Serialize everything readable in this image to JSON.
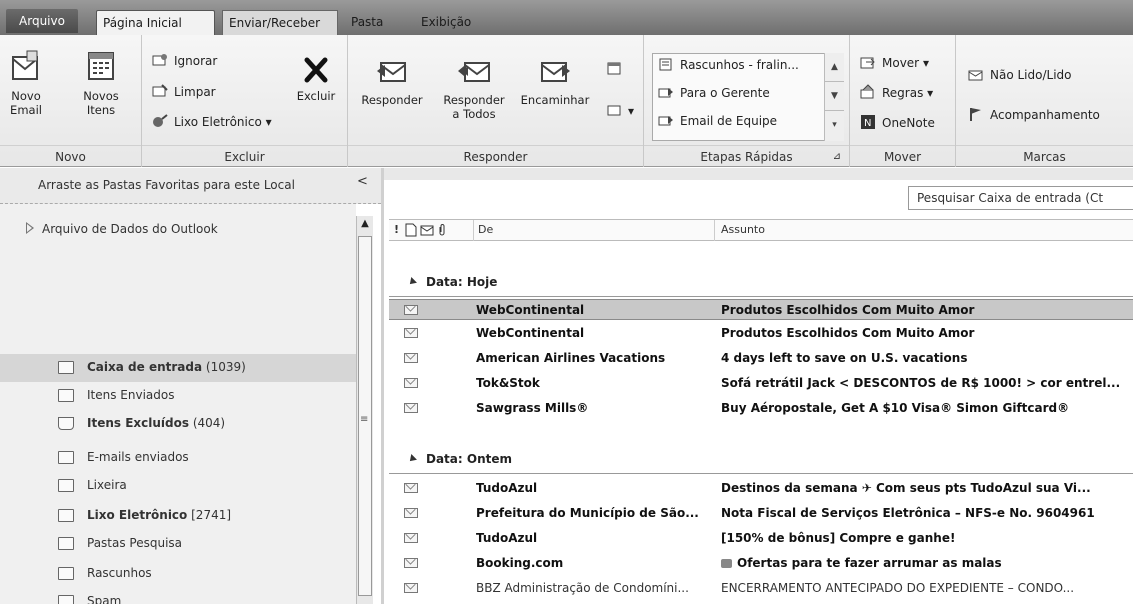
{
  "tabs": {
    "file": "Arquivo",
    "items": [
      "Página Inicial",
      "Enviar/Receber",
      "Pasta",
      "Exibição"
    ]
  },
  "ribbon": {
    "novo": {
      "label": "Novo",
      "new_email_1": "Novo",
      "new_email_2": "Email",
      "new_items_1": "Novos",
      "new_items_2": "Itens"
    },
    "excluir": {
      "label": "Excluir",
      "ignore": "Ignorar",
      "clean": "Limpar",
      "junk": "Lixo Eletrônico",
      "delete": "Excluir"
    },
    "responder": {
      "label": "Responder",
      "reply": "Responder",
      "reply_all_1": "Responder",
      "reply_all_2": "a Todos",
      "forward": "Encaminhar"
    },
    "quick_steps": {
      "label": "Etapas Rápidas",
      "items": [
        "Rascunhos - fralin...",
        "Para o Gerente",
        "Email de Equipe"
      ]
    },
    "mover": {
      "label": "Mover",
      "move": "Mover",
      "rules": "Regras",
      "onenote": "OneNote"
    },
    "marcas": {
      "label": "Marcas",
      "unread_read": "Não Lido/Lido",
      "followup": "Acompanhamento"
    }
  },
  "nav": {
    "favorites_hint": "Arraste as Pastas Favoritas para este Local",
    "collapse": "<",
    "root": "Arquivo de Dados do Outlook",
    "folders": [
      {
        "name": "Caixa de entrada",
        "count": "(1039)",
        "bold": true,
        "selected": true
      },
      {
        "name": "Itens Enviados",
        "count": "",
        "bold": false,
        "selected": false
      },
      {
        "name": "Itens Excluídos",
        "count": "(404)",
        "bold": true,
        "selected": false
      },
      {
        "name": "E-mails enviados",
        "count": "",
        "bold": false,
        "selected": false
      },
      {
        "name": "Lixeira",
        "count": "",
        "bold": false,
        "selected": false
      },
      {
        "name": "Lixo Eletrônico",
        "count": "[2741]",
        "bold": true,
        "selected": false
      },
      {
        "name": "Pastas Pesquisa",
        "count": "",
        "bold": false,
        "selected": false
      },
      {
        "name": "Rascunhos",
        "count": "",
        "bold": false,
        "selected": false
      },
      {
        "name": "Spam",
        "count": "",
        "bold": false,
        "selected": false
      }
    ]
  },
  "list": {
    "search_placeholder": "Pesquisar Caixa de entrada (Ct",
    "columns": {
      "importance": "!",
      "from": "De",
      "subject": "Assunto"
    },
    "groups": [
      {
        "title": "Data: Hoje",
        "rows": [
          {
            "from": "WebContinental",
            "subject": "Produtos Escolhidos Com Muito Amor",
            "unread": true,
            "selected": true
          },
          {
            "from": "WebContinental",
            "subject": "Produtos Escolhidos Com Muito Amor",
            "unread": true,
            "selected": false
          },
          {
            "from": "American Airlines Vacations",
            "subject": "4 days left to save on U.S. vacations",
            "unread": true,
            "selected": false
          },
          {
            "from": "Tok&Stok",
            "subject": "Sofá retrátil Jack < DESCONTOS de R$ 1000! > cor entrel...",
            "unread": true,
            "selected": false
          },
          {
            "from": "Sawgrass Mills®",
            "subject": "Buy Aéropostale, Get A $10 Visa® Simon Giftcard®",
            "unread": true,
            "selected": false
          }
        ]
      },
      {
        "title": "Data: Ontem",
        "rows": [
          {
            "from": "TudoAzul",
            "subject": "Destinos da semana ✈ Com seus pts TudoAzul sua Vi...",
            "unread": true,
            "selected": false
          },
          {
            "from": "Prefeitura do Município de São...",
            "subject": "Nota Fiscal de Serviços Eletrônica – NFS-e No. 9604961",
            "unread": true,
            "selected": false
          },
          {
            "from": "TudoAzul",
            "subject": "[150% de bônus] Compre e ganhe!",
            "unread": true,
            "selected": false
          },
          {
            "from": "Booking.com",
            "subject": "Ofertas para te fazer arrumar as malas",
            "unread": true,
            "selected": false
          },
          {
            "from": "BBZ Administração de Condomíni...",
            "subject": "ENCERRAMENTO ANTECIPADO DO EXPEDIENTE – CONDO...",
            "unread": false,
            "selected": false
          }
        ]
      }
    ]
  }
}
